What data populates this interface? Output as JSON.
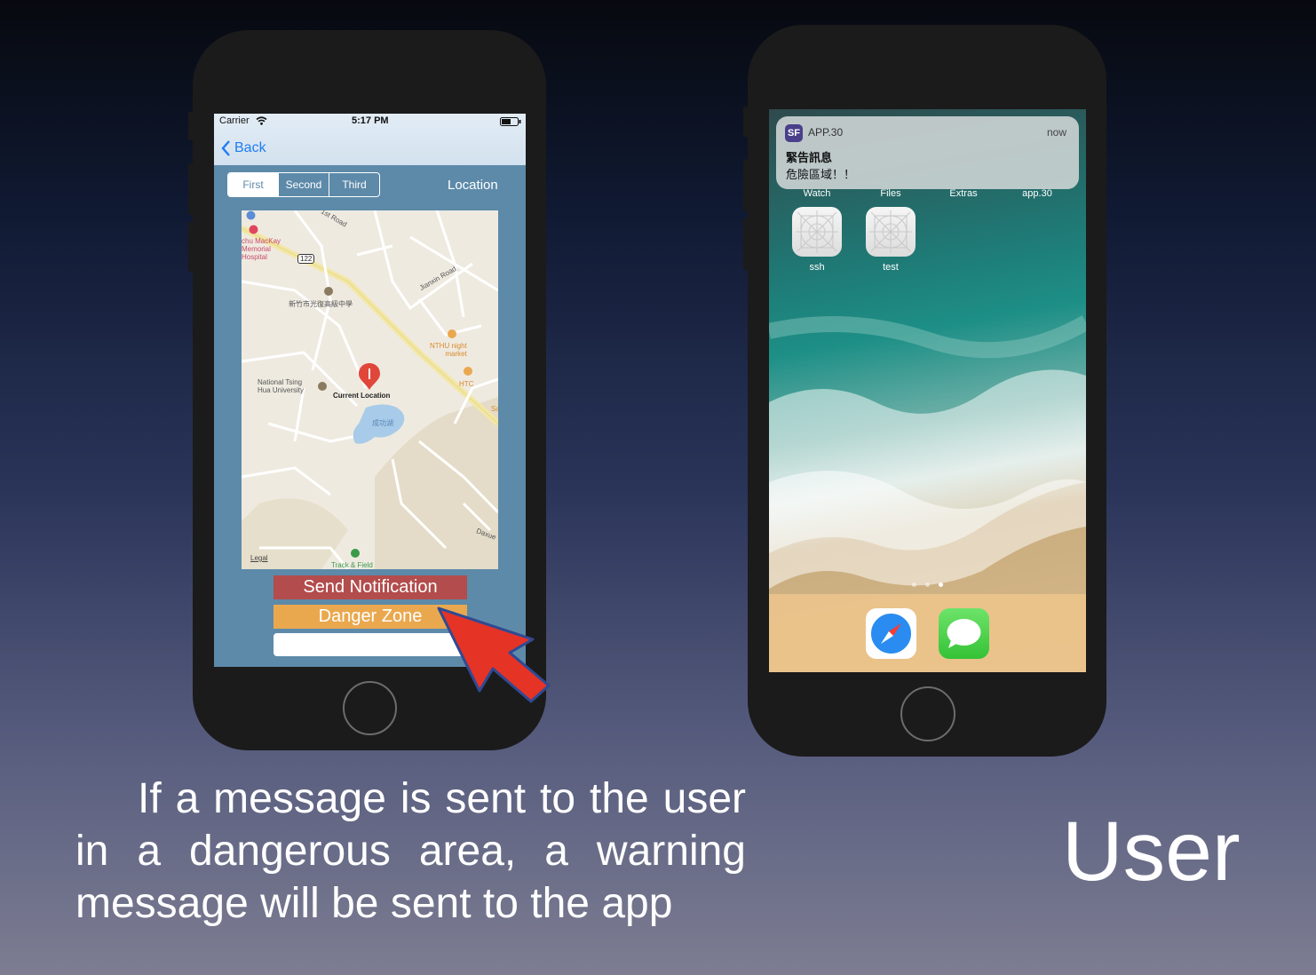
{
  "left_phone": {
    "status": {
      "carrier": "Carrier",
      "time": "5:17 PM"
    },
    "nav": {
      "back_label": "Back"
    },
    "segments": [
      "First",
      "Second",
      "Third"
    ],
    "location_label": "Location",
    "map": {
      "labels": {
        "hospital": "chu MacKay\nMemorial\nHospital",
        "route": "122",
        "school": "新竹市光復高級中學",
        "night_market": "NTHU night\nmarket",
        "university": "National Tsing\nHua University",
        "current_location": "Current Location",
        "lake": "成功湖",
        "htc": "HTC",
        "track": "Track & Field",
        "legal": "Legal",
        "road1": "Jianxin Road",
        "road2": "1st Road",
        "road3": "Daxue",
        "road_edge": "Sa"
      }
    },
    "send_button": "Send Notification",
    "danger_button": "Danger Zone",
    "colors": {
      "send": "#b34c4c",
      "danger": "#eaa84e",
      "panel": "#5d8aa9",
      "arrow": "#e53326"
    }
  },
  "right_phone": {
    "notification": {
      "app": "APP.30",
      "time": "now",
      "title": "緊告訊息",
      "body": "危險區域！！"
    },
    "top_row_labels": [
      "Watch",
      "Files",
      "Extras",
      "app.30"
    ],
    "apps": [
      {
        "label": "ssh"
      },
      {
        "label": "test"
      }
    ],
    "dock": [
      {
        "icon": "safari-icon"
      },
      {
        "icon": "messages-icon"
      }
    ]
  },
  "caption": "If a message is sent to the user in a dangerous area, a warning message will be sent to the app",
  "title": "User"
}
